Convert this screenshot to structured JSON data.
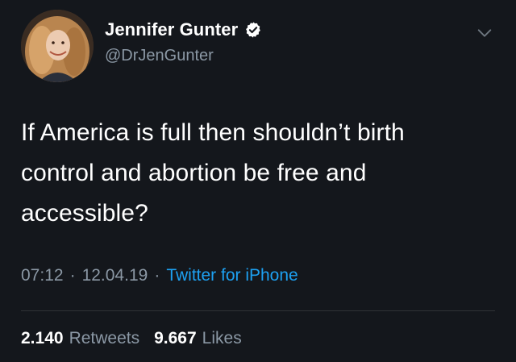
{
  "author": {
    "display_name": "Jennifer Gunter",
    "handle": "@DrJenGunter",
    "avatar_icon": "profile-photo",
    "verified_icon": "verified-badge-icon"
  },
  "tweet": {
    "text_lines": [
      "If America is full then shouldn’t birth",
      "control and abortion be free and",
      "accessible?"
    ],
    "time": "07:12",
    "separator": "·",
    "date": "12.04.19",
    "source": "Twitter for iPhone"
  },
  "stats": {
    "retweets_count": "2.140",
    "retweets_label": "Retweets",
    "likes_count": "9.667",
    "likes_label": "Likes"
  },
  "colors": {
    "background": "#14171c",
    "text": "#ffffff",
    "muted": "#8b98a5",
    "accent": "#1da1f2"
  }
}
